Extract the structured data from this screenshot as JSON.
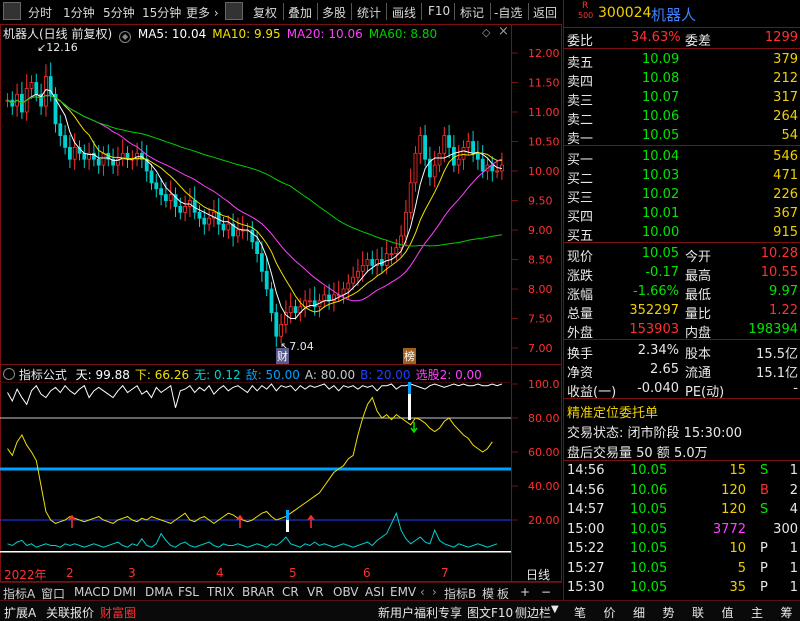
{
  "toolbar": {
    "left": [
      "分时",
      "1分钟",
      "5分钟",
      "15分钟",
      "更多 ›"
    ],
    "right": [
      "复权",
      "叠加",
      "多股",
      "统计",
      "画线",
      "F10",
      "标记",
      "-自选",
      "返回"
    ]
  },
  "main_chart": {
    "title": "机器人(日线 前复权)",
    "ma": [
      {
        "label": "MA5: 10.04",
        "color": "#ffffff"
      },
      {
        "label": "MA10: 9.95",
        "color": "#f0e000"
      },
      {
        "label": "MA20: 10.06",
        "color": "#ff40ff"
      },
      {
        "label": "MA60: 8.80",
        "color": "#00d000"
      }
    ],
    "high_mark": "12.16",
    "low_mark": "7.04",
    "tag_cai": "财",
    "tag_bang": "榜",
    "y_ticks": [
      "12.00",
      "11.50",
      "11.00",
      "10.50",
      "10.00",
      "9.50",
      "9.00",
      "8.50",
      "8.00",
      "7.50",
      "7.00"
    ]
  },
  "indicator": {
    "title": "指标公式",
    "items": [
      {
        "label": "天: 99.88",
        "color": "#ffffff"
      },
      {
        "label": "下: 66.26",
        "color": "#f0e000"
      },
      {
        "label": "无: 0.12",
        "color": "#00d0d0"
      },
      {
        "label": "敌: 50.00",
        "color": "#00a0ff"
      },
      {
        "label": "A: 80.00",
        "color": "#c8c8c8"
      },
      {
        "label": "B: 20.00",
        "color": "#2040ff"
      },
      {
        "label": "选股2: 0.00",
        "color": "#ff40ff"
      }
    ],
    "y_ticks": [
      "100.0",
      "80.00",
      "60.00",
      "40.00",
      "20.00"
    ]
  },
  "x_axis": {
    "labels": [
      "2022年",
      "2",
      "3",
      "4",
      "5",
      "6",
      "7"
    ],
    "right_label": "日线"
  },
  "tabs": [
    "指标A",
    "窗口",
    "MACD",
    "DMI",
    "DMA",
    "FSL",
    "TRIX",
    "BRAR",
    "CR",
    "VR",
    "OBV",
    "ASI",
    "EMV"
  ],
  "tabs_right": [
    "指标B",
    "模",
    "板"
  ],
  "quote": {
    "logo_r": "R",
    "logo_num": "500",
    "code": "300024",
    "name": "机器人",
    "weibi_label": "委比",
    "weibi": "34.63%",
    "weicha_label": "委差",
    "weicha": "1299",
    "asks": [
      {
        "label": "卖五",
        "price": "10.09",
        "vol": "379"
      },
      {
        "label": "卖四",
        "price": "10.08",
        "vol": "212"
      },
      {
        "label": "卖三",
        "price": "10.07",
        "vol": "317"
      },
      {
        "label": "卖二",
        "price": "10.06",
        "vol": "264"
      },
      {
        "label": "卖一",
        "price": "10.05",
        "vol": "54"
      }
    ],
    "bids": [
      {
        "label": "买一",
        "price": "10.04",
        "vol": "546"
      },
      {
        "label": "买二",
        "price": "10.03",
        "vol": "471"
      },
      {
        "label": "买三",
        "price": "10.02",
        "vol": "226"
      },
      {
        "label": "买四",
        "price": "10.01",
        "vol": "367"
      },
      {
        "label": "买五",
        "price": "10.00",
        "vol": "915"
      }
    ],
    "stats": [
      {
        "l1": "现价",
        "v1": "10.05",
        "c1": "#00e600",
        "l2": "今开",
        "v2": "10.28",
        "c2": "#ff3030"
      },
      {
        "l1": "涨跌",
        "v1": "-0.17",
        "c1": "#00e600",
        "l2": "最高",
        "v2": "10.55",
        "c2": "#ff3030"
      },
      {
        "l1": "涨幅",
        "v1": "-1.66%",
        "c1": "#00e600",
        "l2": "最低",
        "v2": "9.97",
        "c2": "#00e600"
      },
      {
        "l1": "总量",
        "v1": "352297",
        "c1": "#f0d000",
        "l2": "量比",
        "v2": "1.22",
        "c2": "#ff3030"
      },
      {
        "l1": "外盘",
        "v1": "153903",
        "c1": "#ff3030",
        "l2": "内盘",
        "v2": "198394",
        "c2": "#00e600"
      }
    ],
    "stats2": [
      {
        "l1": "换手",
        "v1": "2.34%",
        "l2": "股本",
        "v2": "15.5亿"
      },
      {
        "l1": "净资",
        "v1": "2.65",
        "l2": "流通",
        "v2": "15.1亿"
      },
      {
        "l1": "收益(一)",
        "v1": "-0.040",
        "l2": "PE(动)",
        "v2": "-"
      }
    ],
    "order_title": "精准定位委托单",
    "trade_status": "交易状态: 闭市阶段 15:30:00",
    "after_hours": "盘后交易量 50 额 5.0万",
    "ticks": [
      {
        "t": "14:56",
        "p": "10.05",
        "v": "15",
        "vc": "#f0d000",
        "d": "S",
        "dc": "#00e600",
        "n": "1"
      },
      {
        "t": "14:56",
        "p": "10.06",
        "v": "120",
        "vc": "#f0d000",
        "d": "B",
        "dc": "#ff3030",
        "n": "2"
      },
      {
        "t": "14:57",
        "p": "10.05",
        "v": "120",
        "vc": "#f0d000",
        "d": "S",
        "dc": "#00e600",
        "n": "4"
      },
      {
        "t": "15:00",
        "p": "10.05",
        "v": "3772",
        "vc": "#ff40ff",
        "d": "",
        "dc": "#00e600",
        "n": "300"
      },
      {
        "t": "15:22",
        "p": "10.05",
        "v": "10",
        "vc": "#f0d000",
        "d": "P",
        "dc": "#e8e8e8",
        "n": "1"
      },
      {
        "t": "15:27",
        "p": "10.05",
        "v": "5",
        "vc": "#f0d000",
        "d": "P",
        "dc": "#e8e8e8",
        "n": "1"
      },
      {
        "t": "15:30",
        "p": "10.05",
        "v": "35",
        "vc": "#f0d000",
        "d": "P",
        "dc": "#e8e8e8",
        "n": "1"
      }
    ]
  },
  "bottom": {
    "left": [
      "扩展A",
      "关联报价",
      "财富圈"
    ],
    "promo": "新用户福利专享",
    "tuwen": "图文F10",
    "sidebar": "侧边栏",
    "right": [
      "笔",
      "价",
      "细",
      "势",
      "联",
      "值",
      "主",
      "筹"
    ]
  }
}
